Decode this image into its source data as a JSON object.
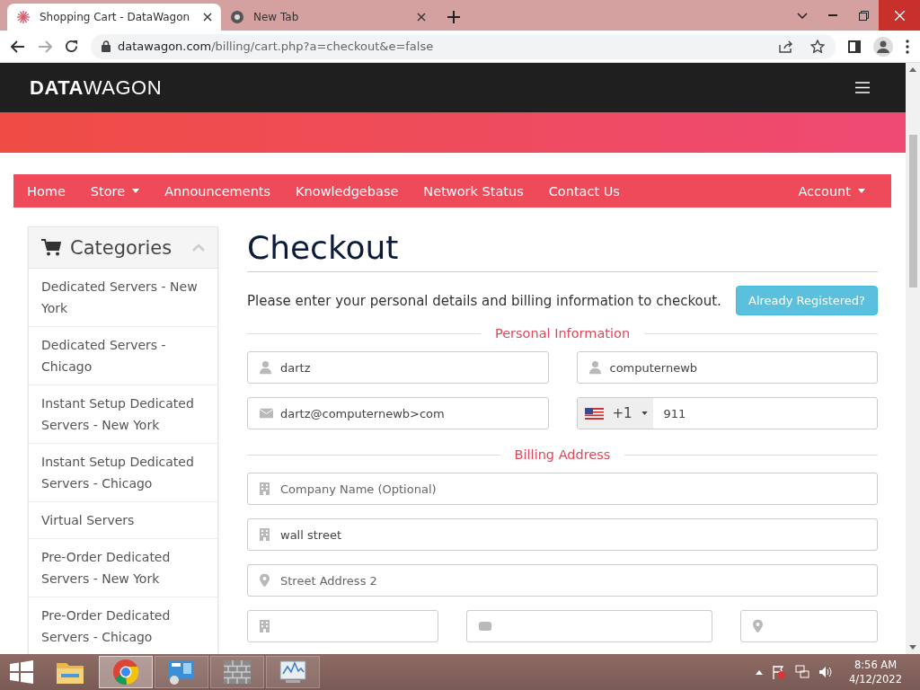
{
  "browser": {
    "tabs": [
      {
        "title": "Shopping Cart - DataWagon",
        "selected": true
      },
      {
        "title": "New Tab",
        "selected": false
      }
    ],
    "address_host": "datawagon.com",
    "address_path": "/billing/cart.php?a=checkout&e=false"
  },
  "site": {
    "logo": "**DATA**WAGON",
    "nav": [
      {
        "label": "Home",
        "dropdown": false
      },
      {
        "label": "Store",
        "dropdown": true
      },
      {
        "label": "Announcements",
        "dropdown": false
      },
      {
        "label": "Knowledgebase",
        "dropdown": false
      },
      {
        "label": "Network Status",
        "dropdown": false
      },
      {
        "label": "Contact Us",
        "dropdown": false
      }
    ],
    "account": {
      "label": "Account",
      "dropdown": true
    }
  },
  "sidebar": {
    "title": "Categories",
    "items": [
      "Dedicated Servers - New York",
      "Dedicated Servers - Chicago",
      "Instant Setup Dedicated Servers - New York",
      "Instant Setup Dedicated Servers - Chicago",
      "Virtual Servers",
      "Pre-Order Dedicated Servers - New York",
      "Pre-Order Dedicated Servers - Chicago"
    ]
  },
  "checkout": {
    "title": "Checkout",
    "intro": "Please enter your personal details and billing information to checkout.",
    "login_button": "Already Registered?",
    "sections": [
      {
        "heading": "Personal Information",
        "rows": [
          [
            {
              "kind": "text",
              "value": "dartz"
            },
            {
              "kind": "text",
              "value": "computernewb"
            }
          ],
          [
            {
              "kind": "text",
              "value": "dartz@computernewb>com"
            },
            {
              "kind": "phone",
              "code": "+1",
              "value": "911"
            }
          ]
        ]
      },
      {
        "heading": "Billing Address",
        "rows": [
          [
            {
              "kind": "text",
              "placeholder": "Company Name (Optional)"
            }
          ],
          [
            {
              "kind": "text",
              "value": "wall street"
            }
          ],
          [
            {
              "kind": "text",
              "placeholder": "Street Address 2"
            }
          ],
          [
            {
              "kind": "text"
            },
            {
              "kind": "text"
            },
            {
              "kind": "text"
            }
          ]
        ]
      }
    ]
  },
  "taskbar": {
    "apps": [
      {
        "kind": "folder",
        "selected": false
      },
      {
        "kind": "browser",
        "selected": true
      },
      {
        "kind": "control-panel",
        "selected": false
      },
      {
        "kind": "wall",
        "selected": false
      },
      {
        "kind": "monitor",
        "selected": false
      }
    ],
    "time": "8:56 AM",
    "date": "4/12/2022"
  }
}
